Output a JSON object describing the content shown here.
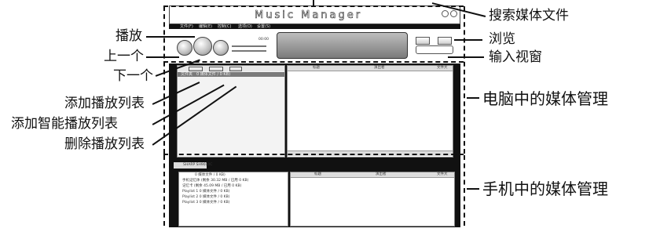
{
  "app": {
    "title": "Music Manager",
    "menu": [
      "文件(F)",
      "编辑(E)",
      "控制(C)",
      "选项(O)",
      "设置(S)"
    ],
    "time": "00:00"
  },
  "computer_panel": {
    "tree_item": "文件夹",
    "tree_item_detail": "0 媒体文件 / 0 KB)",
    "columns": [
      "标题",
      "演出者",
      "文件大"
    ]
  },
  "phone_panel": {
    "device_name": "SHARP SH9010C",
    "tree_items": [
      "0 媒体文件 / 0 KB)",
      "手机记忆体  (剩余 30.32 MB / 已用 0 KB)",
      "记忆卡  (剩余 45.09 MB / 已用 0 KB)",
      "Playlist 1  0 媒体文件 / 0 KB)",
      "Playlist 2  0 媒体文件 / 0 KB)",
      "Playlist 3  0 媒体文件 / 0 KB)"
    ],
    "columns": [
      "标题",
      "演出者",
      "文件大"
    ]
  },
  "callouts": {
    "play": "播放",
    "previous": "上一个",
    "next": "下一个",
    "add_playlist": "添加播放列表",
    "add_smart_playlist": "添加智能播放列表",
    "delete_playlist": "删除播放列表",
    "search_media": "搜索媒体文件",
    "browse": "浏览",
    "input_window": "输入视窗",
    "pc_media_mgmt": "电脑中的媒体管理",
    "phone_media_mgmt": "手机中的媒体管理"
  }
}
